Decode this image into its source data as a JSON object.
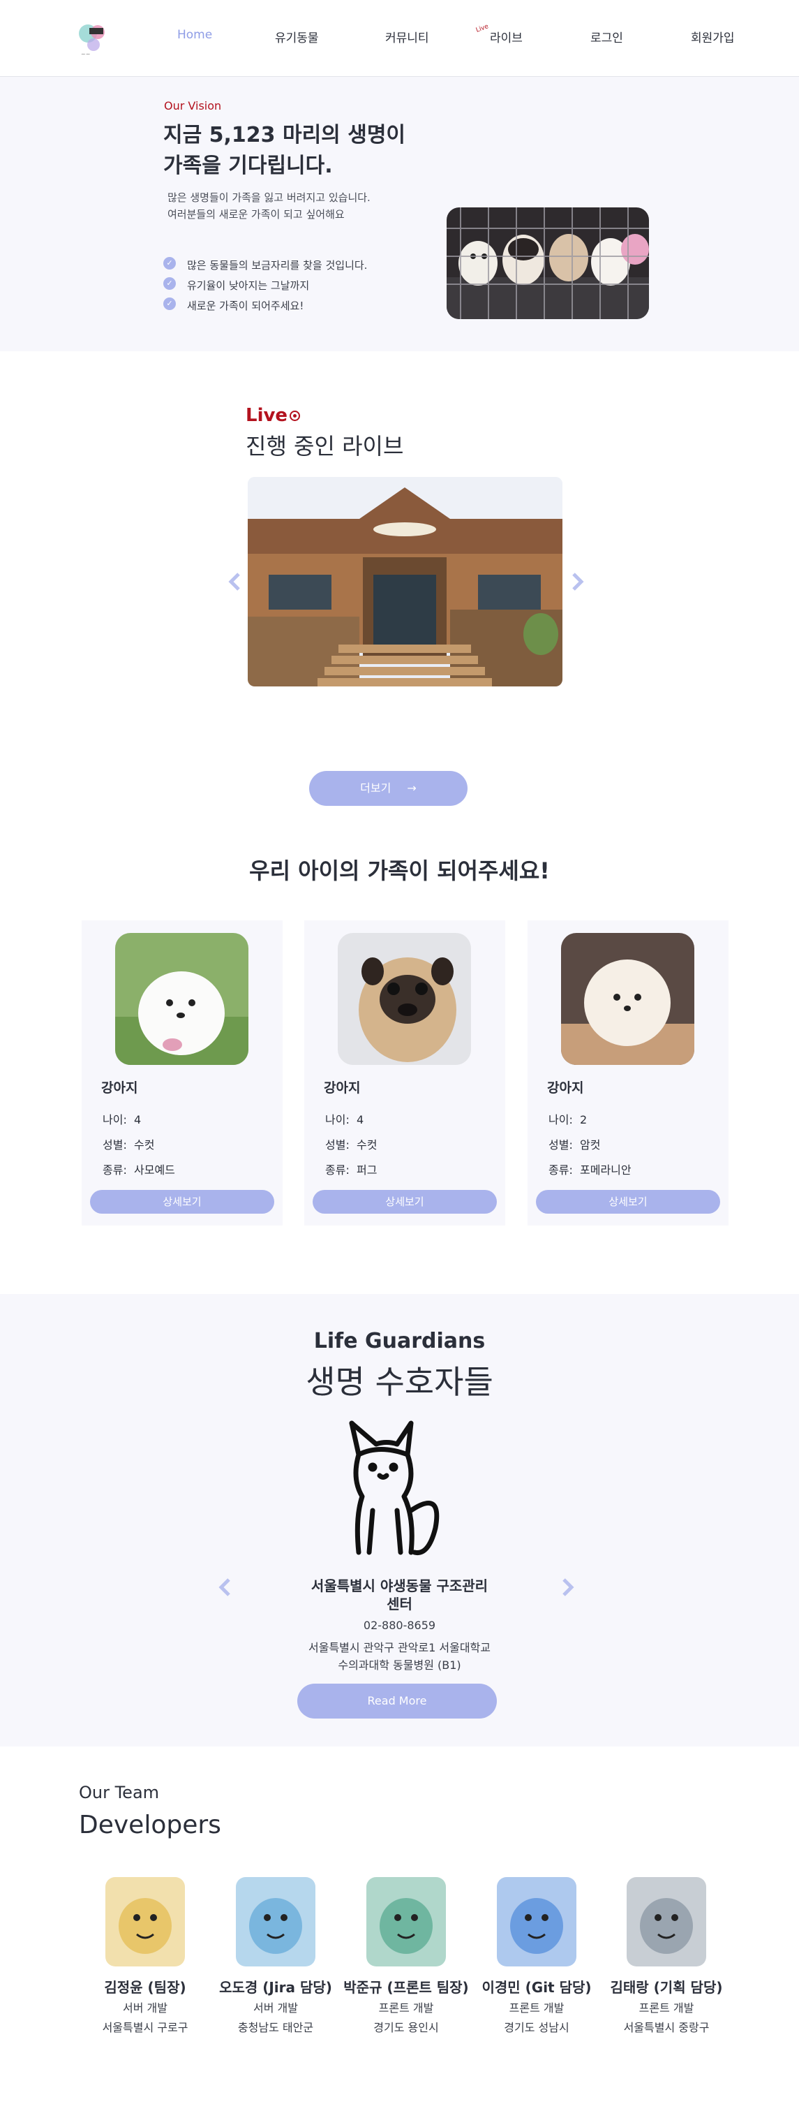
{
  "nav": {
    "items": [
      {
        "label": "Home"
      },
      {
        "label": "유기동물"
      },
      {
        "label": "커뮤니티"
      },
      {
        "label": "라이브",
        "badge": "Live"
      },
      {
        "label": "로그인"
      },
      {
        "label": "회원가입"
      }
    ]
  },
  "vision": {
    "eyebrow": "Our Vision",
    "title_line1": "지금 5,123 마리의 생명이",
    "title_line2": "가족을 기다립니다.",
    "desc_line1": "많은 생명들이 가족을 잃고 버려지고 있습니다.",
    "desc_line2": "여러분들의 새로운 가족이 되고 싶어해요",
    "bullets": [
      "많은 동물들의 보금자리를 찾을 것입니다.",
      "유기율이 낮아지는 그날까지",
      "새로운 가족이 되어주세요!"
    ]
  },
  "live": {
    "label": "Live",
    "live_icon": "radio-dot-icon",
    "title": "진행 중인 라이브",
    "more_button": "더보기"
  },
  "adopt": {
    "title": "우리 아이의 가족이 되어주세요!",
    "labels": {
      "age": "나이:",
      "gender": "성별:",
      "breed": "종류:"
    },
    "cards": [
      {
        "name": "강아지",
        "age": "4",
        "gender": "수컷",
        "breed": "사모예드",
        "button": "상세보기"
      },
      {
        "name": "강아지",
        "age": "4",
        "gender": "수컷",
        "breed": "퍼그",
        "button": "상세보기"
      },
      {
        "name": "강아지",
        "age": "2",
        "gender": "암컷",
        "breed": "포메라니안",
        "button": "상세보기"
      }
    ]
  },
  "guardians": {
    "title_en": "Life Guardians",
    "title_ko": "생명 수호자들",
    "org_line1": "서울특별시 야생동물 구조관리",
    "org_line2": "센터",
    "phone": "02-880-8659",
    "addr_line1": "서울특별시 관악구 관악로1 서울대학교",
    "addr_line2": "수의과대학 동물병원 (B1)",
    "button": "Read More"
  },
  "team": {
    "eyebrow": "Our Team",
    "title": "Developers",
    "members": [
      {
        "name": "김정윤 (팀장)",
        "role": "서버 개발",
        "region": "서울특별시 구로구",
        "color": "#e8c66a"
      },
      {
        "name": "오도경 (Jira 담당)",
        "role": "서버 개발",
        "region": "충청남도 태안군",
        "color": "#7ab6de"
      },
      {
        "name": "박준규 (프론트 팀장)",
        "role": "프론트 개발",
        "region": "경기도 용인시",
        "color": "#6fb6a0"
      },
      {
        "name": "이경민 (Git 담당)",
        "role": "프론트 개발",
        "region": "경기도 성남시",
        "color": "#6b9de0"
      },
      {
        "name": "김태랑 (기획 담당)",
        "role": "프론트 개발",
        "region": "서울특별시 중랑구",
        "color": "#9aa5b0"
      }
    ]
  },
  "colors": {
    "accent": "#a9b3ec",
    "live_red": "#b3121e",
    "section_bg": "#f7f7fc"
  }
}
